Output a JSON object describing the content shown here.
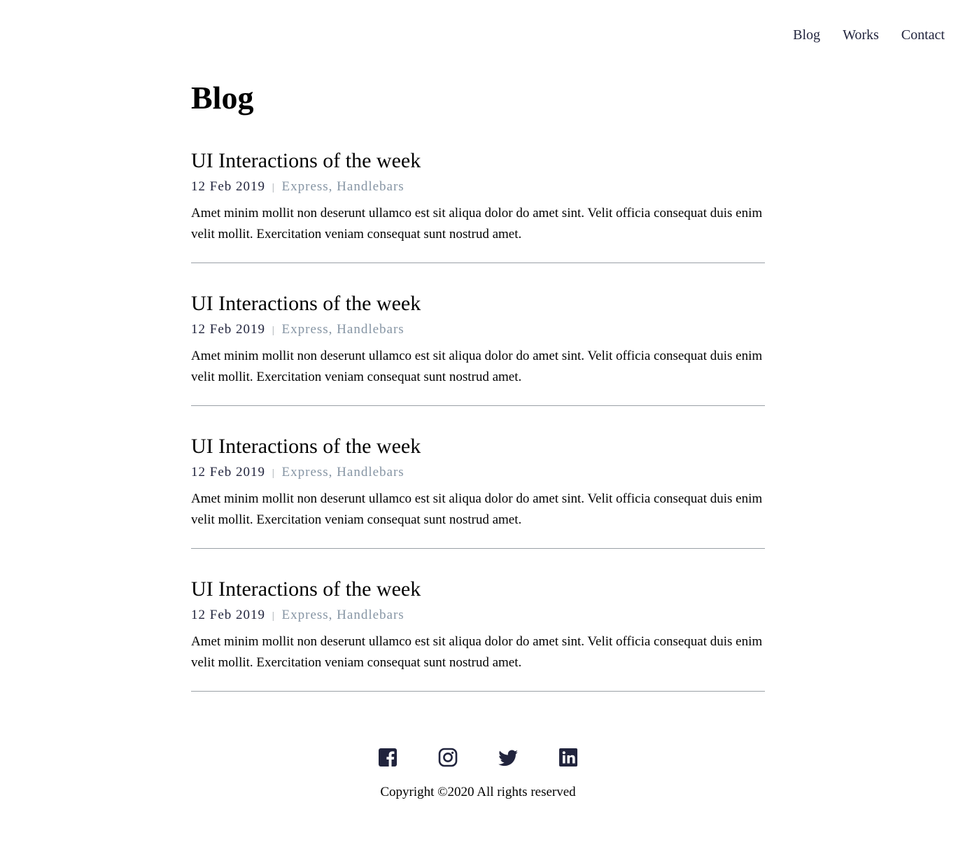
{
  "nav": {
    "items": [
      "Blog",
      "Works",
      "Contact"
    ]
  },
  "page": {
    "title": "Blog"
  },
  "posts": [
    {
      "title": "UI Interactions of the week",
      "date": "12 Feb 2019",
      "separator": "|",
      "tags": "Express, Handlebars",
      "excerpt": "Amet minim mollit non deserunt ullamco est sit aliqua dolor do amet sint. Velit officia consequat duis enim velit mollit. Exercitation veniam consequat sunt nostrud amet."
    },
    {
      "title": "UI Interactions of the week",
      "date": "12 Feb 2019",
      "separator": "|",
      "tags": "Express, Handlebars",
      "excerpt": "Amet minim mollit non deserunt ullamco est sit aliqua dolor do amet sint. Velit officia consequat duis enim velit mollit. Exercitation veniam consequat sunt nostrud amet."
    },
    {
      "title": "UI Interactions of the week",
      "date": "12 Feb 2019",
      "separator": "|",
      "tags": "Express, Handlebars",
      "excerpt": "Amet minim mollit non deserunt ullamco est sit aliqua dolor do amet sint. Velit officia consequat duis enim velit mollit. Exercitation veniam consequat sunt nostrud amet."
    },
    {
      "title": "UI Interactions of the week",
      "date": "12 Feb 2019",
      "separator": "|",
      "tags": "Express, Handlebars",
      "excerpt": "Amet minim mollit non deserunt ullamco est sit aliqua dolor do amet sint. Velit officia consequat duis enim velit mollit. Exercitation veniam consequat sunt nostrud amet."
    }
  ],
  "footer": {
    "social_icons": [
      "facebook-icon",
      "instagram-icon",
      "twitter-icon",
      "linkedin-icon"
    ],
    "copyright": "Copyright ©2020 All rights reserved"
  },
  "colors": {
    "text": "#000000",
    "nav": "#21243d",
    "tags": "#8695a4",
    "divider": "#9aa0a6",
    "icon": "#21243d"
  }
}
